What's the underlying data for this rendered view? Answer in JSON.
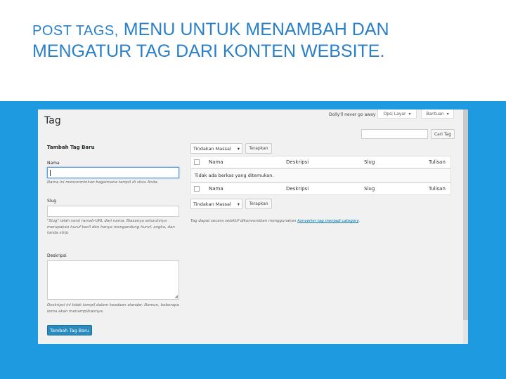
{
  "slide": {
    "title_caps": "POST TAGS,",
    "title_rest": " MENU UNTUK MENAMBAH DAN",
    "title_line2": "MENGATUR TAG DARI KONTEN WEBSITE."
  },
  "wp": {
    "page_title": "Tag",
    "top_text": "Dolly'll never go away",
    "screen_options": "Opsi Layar",
    "help": "Bantuan",
    "search_button": "Cari Tag",
    "add_section_title": "Tambah Tag Baru",
    "name_label": "Nama",
    "name_hint": "Nama ini mencerminkan bagaimana tampil di situs Anda.",
    "slug_label": "Slug",
    "slug_hint": "\"Slug\" ialah versi ramah-URL dari nama. Biasanya seluruhnya merupakan huruf kecil dan hanya mengandung huruf, angka, dan tanda strip.",
    "desc_label": "Deskripsi",
    "desc_hint": "Deskripsi ini tidak tampil dalam keadaan standar. Namun, beberapa tema akan menampilkannya.",
    "add_button": "Tambah Tag Baru",
    "bulk_action": "Tindakan Massal",
    "apply": "Terapkan",
    "columns": [
      "Nama",
      "Deskripsi",
      "Slug",
      "Tulisan"
    ],
    "empty_message": "Tidak ada berkas yang ditemukan.",
    "convert_text": "Tag dapat secara selektif dikonversikan menggunakan",
    "convert_link": "konverter tag menjadi category"
  }
}
